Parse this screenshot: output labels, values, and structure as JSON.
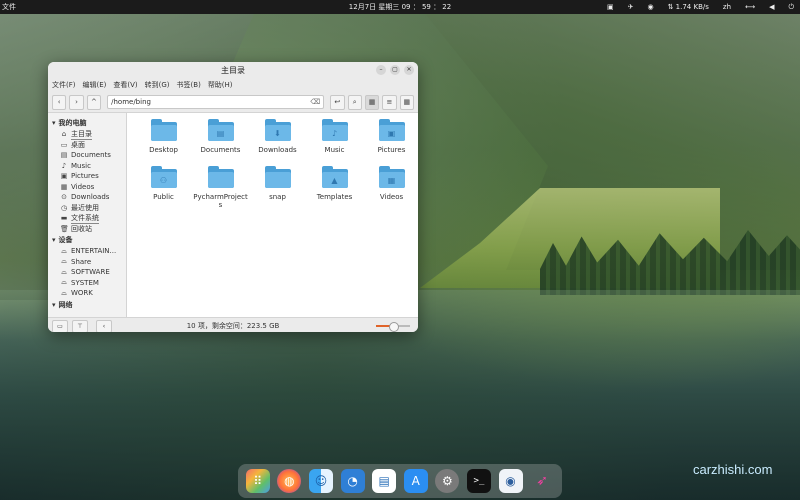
{
  "topbar": {
    "left_label": "文件",
    "clock": "12月7日 星期三  09 ： 59 ： 22",
    "net_speed": "1.74 KB/s",
    "input_method": "zh"
  },
  "window": {
    "title": "主目录",
    "menu": [
      "文件(F)",
      "编辑(E)",
      "查看(V)",
      "转到(G)",
      "书签(B)",
      "帮助(H)"
    ],
    "path": "/home/bing",
    "sidebar": {
      "my_computer": {
        "header": "我的电脑",
        "items": [
          {
            "icon": "home-icon",
            "glyph": "⌂",
            "label": "主目录"
          },
          {
            "icon": "desktop-icon",
            "glyph": "▭",
            "label": "桌面"
          },
          {
            "icon": "documents-icon",
            "glyph": "▤",
            "label": "Documents"
          },
          {
            "icon": "music-icon",
            "glyph": "♪",
            "label": "Music"
          },
          {
            "icon": "pictures-icon",
            "glyph": "▣",
            "label": "Pictures"
          },
          {
            "icon": "videos-icon",
            "glyph": "▦",
            "label": "Videos"
          },
          {
            "icon": "downloads-icon",
            "glyph": "⊙",
            "label": "Downloads"
          },
          {
            "icon": "recent-icon",
            "glyph": "◷",
            "label": "最近使用"
          },
          {
            "icon": "filesystem-icon",
            "glyph": "▬",
            "label": "文件系统"
          },
          {
            "icon": "trash-icon",
            "glyph": "🗑",
            "label": "回收站"
          }
        ]
      },
      "devices": {
        "header": "设备",
        "items": [
          {
            "icon": "drive-icon",
            "glyph": "⌓",
            "label": "ENTERTAIN..."
          },
          {
            "icon": "drive-icon",
            "glyph": "⌓",
            "label": "Share"
          },
          {
            "icon": "drive-icon",
            "glyph": "⌓",
            "label": "SOFTWARE"
          },
          {
            "icon": "drive-icon",
            "glyph": "⌓",
            "label": "SYSTEM"
          },
          {
            "icon": "drive-icon",
            "glyph": "⌓",
            "label": "WORK"
          }
        ]
      },
      "network_header": "网络"
    },
    "files": [
      {
        "name": "Desktop",
        "emblem": ""
      },
      {
        "name": "Documents",
        "emblem": "▤"
      },
      {
        "name": "Downloads",
        "emblem": "⬇"
      },
      {
        "name": "Music",
        "emblem": "♪"
      },
      {
        "name": "Pictures",
        "emblem": "▣"
      },
      {
        "name": "Public",
        "emblem": "⚇"
      },
      {
        "name": "PycharmProject\ns",
        "emblem": ""
      },
      {
        "name": "snap",
        "emblem": ""
      },
      {
        "name": "Templates",
        "emblem": "▲"
      },
      {
        "name": "Videos",
        "emblem": "▦"
      }
    ],
    "status": "10 项，剩余空间：223.5 GB",
    "zoom_level": 0.5
  },
  "dock": [
    "launchpad-icon",
    "firefox-icon",
    "finder-icon",
    "linux-icon",
    "document-viewer-icon",
    "app-store-icon",
    "settings-icon",
    "terminal-icon",
    "screenshot-icon",
    "swift-icon"
  ],
  "watermark": "carzhishi.com",
  "colors": {
    "accent": "#e0642a",
    "folder": "#4a9fd6"
  }
}
